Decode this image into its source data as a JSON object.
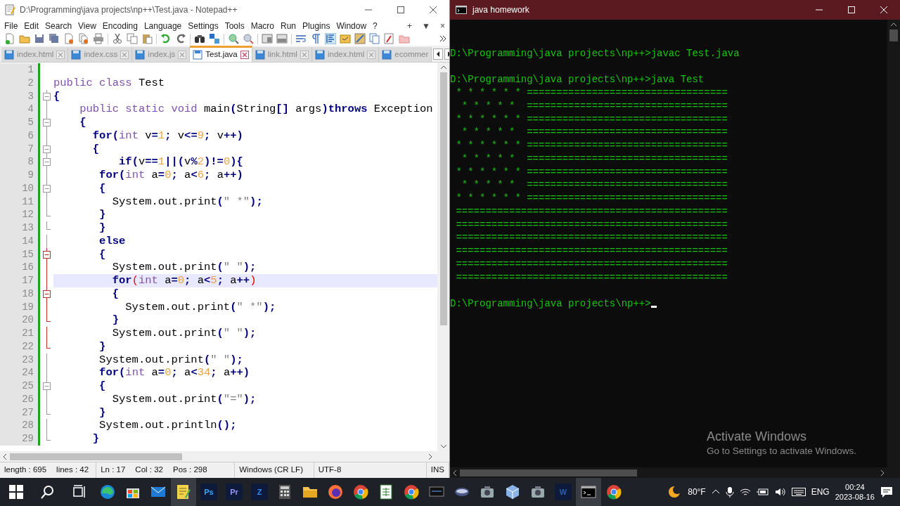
{
  "editor_window": {
    "title": "D:\\Programming\\java projects\\np++\\Test.java - Notepad++",
    "menu": [
      "File",
      "Edit",
      "Search",
      "View",
      "Encoding",
      "Language",
      "Settings",
      "Tools",
      "Macro",
      "Run",
      "Plugins",
      "Window",
      "?"
    ],
    "menu_extras": [
      "+",
      "▼",
      "×"
    ],
    "tabs": [
      {
        "label": "index.html",
        "selected": false
      },
      {
        "label": "index.css",
        "selected": false
      },
      {
        "label": "index.js",
        "selected": false
      },
      {
        "label": "Test.java",
        "selected": true
      },
      {
        "label": "link.html",
        "selected": false
      },
      {
        "label": "index.html",
        "selected": false
      },
      {
        "label": "ecommer",
        "selected": false
      }
    ],
    "lines": [
      {
        "number": "1",
        "kind": "plain",
        "current": false
      },
      {
        "number": "2",
        "kind": "plain",
        "current": false,
        "tokens": [
          {
            "kind": "modifier",
            "text": "public class"
          },
          {
            "kind": "plain",
            "text": " Test"
          }
        ]
      },
      {
        "number": "3",
        "kind": "open",
        "changed": false,
        "current": false,
        "tokens": [
          {
            "kind": "operator",
            "text": "{"
          }
        ]
      },
      {
        "number": "4",
        "kind": "guide",
        "changed": false,
        "current": false,
        "tokens": [
          {
            "kind": "modifier",
            "text": "    public static void"
          },
          {
            "kind": "plain",
            "text": " main"
          },
          {
            "kind": "operator",
            "text": "("
          },
          {
            "kind": "plain",
            "text": "String"
          },
          {
            "kind": "operator",
            "text": "[]"
          },
          {
            "kind": "plain",
            "text": " args"
          },
          {
            "kind": "operator",
            "text": ")"
          },
          {
            "kind": "keyword",
            "text": "throws"
          },
          {
            "kind": "plain",
            "text": " Exception"
          }
        ]
      },
      {
        "number": "5",
        "kind": "open",
        "changed": false,
        "current": false,
        "tokens": [
          {
            "kind": "operator",
            "text": "    {"
          }
        ]
      },
      {
        "number": "6",
        "kind": "guide",
        "changed": false,
        "current": false,
        "tokens": [
          {
            "kind": "keyword",
            "text": "      for"
          },
          {
            "kind": "operator",
            "text": "("
          },
          {
            "kind": "modifier",
            "text": "int"
          },
          {
            "kind": "plain",
            "text": " v"
          },
          {
            "kind": "operator",
            "text": "="
          },
          {
            "kind": "number",
            "text": "1"
          },
          {
            "kind": "operator",
            "text": ";"
          },
          {
            "kind": "plain",
            "text": " v"
          },
          {
            "kind": "operator",
            "text": "<="
          },
          {
            "kind": "number",
            "text": "9"
          },
          {
            "kind": "operator",
            "text": ";"
          },
          {
            "kind": "plain",
            "text": " v"
          },
          {
            "kind": "operator",
            "text": "++)"
          }
        ]
      },
      {
        "number": "7",
        "kind": "open",
        "changed": false,
        "current": false,
        "tokens": [
          {
            "kind": "operator",
            "text": "      {"
          }
        ]
      },
      {
        "number": "8",
        "kind": "open",
        "changed": false,
        "current": false,
        "tokens": [
          {
            "kind": "keyword",
            "text": "          if"
          },
          {
            "kind": "operator",
            "text": "("
          },
          {
            "kind": "plain",
            "text": "v"
          },
          {
            "kind": "operator",
            "text": "=="
          },
          {
            "kind": "number",
            "text": "1"
          },
          {
            "kind": "operator",
            "text": "||("
          },
          {
            "kind": "plain",
            "text": "v"
          },
          {
            "kind": "operator",
            "text": "%"
          },
          {
            "kind": "number",
            "text": "2"
          },
          {
            "kind": "operator",
            "text": ")!="
          },
          {
            "kind": "number",
            "text": "0"
          },
          {
            "kind": "operator",
            "text": "){"
          }
        ]
      },
      {
        "number": "9",
        "kind": "guide",
        "changed": false,
        "current": false,
        "tokens": [
          {
            "kind": "keyword",
            "text": "       for"
          },
          {
            "kind": "operator",
            "text": "("
          },
          {
            "kind": "modifier",
            "text": "int"
          },
          {
            "kind": "plain",
            "text": " a"
          },
          {
            "kind": "operator",
            "text": "="
          },
          {
            "kind": "number",
            "text": "0"
          },
          {
            "kind": "operator",
            "text": ";"
          },
          {
            "kind": "plain",
            "text": " a"
          },
          {
            "kind": "operator",
            "text": "<"
          },
          {
            "kind": "number",
            "text": "6"
          },
          {
            "kind": "operator",
            "text": ";"
          },
          {
            "kind": "plain",
            "text": " a"
          },
          {
            "kind": "operator",
            "text": "++)"
          }
        ]
      },
      {
        "number": "10",
        "kind": "open",
        "changed": false,
        "current": false,
        "tokens": [
          {
            "kind": "operator",
            "text": "       {"
          }
        ]
      },
      {
        "number": "11",
        "kind": "guide",
        "changed": false,
        "current": false,
        "tokens": [
          {
            "kind": "plain",
            "text": "         System.out.print"
          },
          {
            "kind": "operator",
            "text": "("
          },
          {
            "kind": "string",
            "text": "\" *\""
          },
          {
            "kind": "operator",
            "text": ");"
          }
        ]
      },
      {
        "number": "12",
        "kind": "end",
        "changed": false,
        "current": false,
        "tokens": [
          {
            "kind": "operator",
            "text": "       }"
          }
        ]
      },
      {
        "number": "13",
        "kind": "end",
        "changed": false,
        "current": false,
        "tokens": [
          {
            "kind": "operator",
            "text": "       }"
          }
        ]
      },
      {
        "number": "14",
        "kind": "guide",
        "changed": false,
        "current": false,
        "tokens": [
          {
            "kind": "keyword",
            "text": "       else"
          }
        ]
      },
      {
        "number": "15",
        "kind": "open",
        "changed": true,
        "current": false,
        "tokens": [
          {
            "kind": "operator",
            "text": "       {"
          }
        ]
      },
      {
        "number": "16",
        "kind": "guide",
        "changed": true,
        "current": false,
        "tokens": [
          {
            "kind": "plain",
            "text": "         System.out.print"
          },
          {
            "kind": "operator",
            "text": "("
          },
          {
            "kind": "string",
            "text": "\" \""
          },
          {
            "kind": "operator",
            "text": ");"
          }
        ]
      },
      {
        "number": "17",
        "kind": "guide",
        "changed": true,
        "current": true,
        "tokens": [
          {
            "kind": "keyword",
            "text": "         for"
          },
          {
            "kind": "match",
            "text": "("
          },
          {
            "kind": "modifier",
            "text": "int"
          },
          {
            "kind": "plain",
            "text": " a"
          },
          {
            "kind": "operator",
            "text": "="
          },
          {
            "kind": "number",
            "text": "0"
          },
          {
            "kind": "operator",
            "text": ";"
          },
          {
            "kind": "plain",
            "text": " a"
          },
          {
            "kind": "operator",
            "text": "<"
          },
          {
            "kind": "number",
            "text": "5"
          },
          {
            "kind": "operator",
            "text": ";"
          },
          {
            "kind": "plain",
            "text": " a"
          },
          {
            "kind": "operator",
            "text": "++"
          },
          {
            "kind": "match",
            "text": ")"
          }
        ]
      },
      {
        "number": "18",
        "kind": "open",
        "changed": true,
        "current": false,
        "tokens": [
          {
            "kind": "operator",
            "text": "         {"
          }
        ]
      },
      {
        "number": "19",
        "kind": "guide",
        "changed": true,
        "current": false,
        "tokens": [
          {
            "kind": "plain",
            "text": "           System.out.print"
          },
          {
            "kind": "operator",
            "text": "("
          },
          {
            "kind": "string",
            "text": "\" *\""
          },
          {
            "kind": "operator",
            "text": ");"
          }
        ]
      },
      {
        "number": "20",
        "kind": "end",
        "changed": true,
        "current": false,
        "tokens": [
          {
            "kind": "operator",
            "text": "         }"
          }
        ]
      },
      {
        "number": "21",
        "kind": "guide",
        "changed": true,
        "current": false,
        "tokens": [
          {
            "kind": "plain",
            "text": "         System.out.print"
          },
          {
            "kind": "operator",
            "text": "("
          },
          {
            "kind": "string",
            "text": "\" \""
          },
          {
            "kind": "operator",
            "text": ");"
          }
        ]
      },
      {
        "number": "22",
        "kind": "end",
        "changed": true,
        "current": false,
        "tokens": [
          {
            "kind": "operator",
            "text": "       }"
          }
        ]
      },
      {
        "number": "23",
        "kind": "guide",
        "changed": false,
        "current": false,
        "tokens": [
          {
            "kind": "plain",
            "text": "       System.out.print"
          },
          {
            "kind": "operator",
            "text": "("
          },
          {
            "kind": "string",
            "text": "\" \""
          },
          {
            "kind": "operator",
            "text": ");"
          }
        ]
      },
      {
        "number": "24",
        "kind": "guide",
        "changed": false,
        "current": false,
        "tokens": [
          {
            "kind": "keyword",
            "text": "       for"
          },
          {
            "kind": "operator",
            "text": "("
          },
          {
            "kind": "modifier",
            "text": "int"
          },
          {
            "kind": "plain",
            "text": " a"
          },
          {
            "kind": "operator",
            "text": "="
          },
          {
            "kind": "number",
            "text": "0"
          },
          {
            "kind": "operator",
            "text": ";"
          },
          {
            "kind": "plain",
            "text": " a"
          },
          {
            "kind": "operator",
            "text": "<"
          },
          {
            "kind": "number",
            "text": "34"
          },
          {
            "kind": "operator",
            "text": ";"
          },
          {
            "kind": "plain",
            "text": " a"
          },
          {
            "kind": "operator",
            "text": "++)"
          }
        ]
      },
      {
        "number": "25",
        "kind": "open",
        "changed": false,
        "current": false,
        "tokens": [
          {
            "kind": "operator",
            "text": "       {"
          }
        ]
      },
      {
        "number": "26",
        "kind": "guide",
        "changed": false,
        "current": false,
        "tokens": [
          {
            "kind": "plain",
            "text": "         System.out.print"
          },
          {
            "kind": "operator",
            "text": "("
          },
          {
            "kind": "string",
            "text": "\"=\""
          },
          {
            "kind": "operator",
            "text": ");"
          }
        ]
      },
      {
        "number": "27",
        "kind": "end",
        "changed": false,
        "current": false,
        "tokens": [
          {
            "kind": "operator",
            "text": "       }"
          }
        ]
      },
      {
        "number": "28",
        "kind": "guide",
        "changed": false,
        "current": false,
        "tokens": [
          {
            "kind": "plain",
            "text": "       System.out.println"
          },
          {
            "kind": "operator",
            "text": "();"
          }
        ]
      },
      {
        "number": "29",
        "kind": "end",
        "changed": false,
        "current": false,
        "tokens": [
          {
            "kind": "operator",
            "text": "      }"
          }
        ]
      }
    ],
    "status_bar": [
      [
        "length : 695",
        "lines : 42"
      ],
      [
        "Ln : 17",
        "Col : 32",
        "Pos : 298"
      ],
      [
        "Windows (CR LF)"
      ],
      [
        "UTF-8"
      ],
      [
        "INS"
      ]
    ]
  },
  "terminal_window": {
    "title": "java homework",
    "lines": [
      {
        "kind": "blank"
      },
      {
        "kind": "text",
        "text": "D:\\Programming\\java projects\\np++>javac Test.java"
      },
      {
        "kind": "blank"
      },
      {
        "kind": "text",
        "text": "D:\\Programming\\java projects\\np++>java Test"
      },
      {
        "kind": "text",
        "text": " * * * * * * =================================="
      },
      {
        "kind": "text",
        "text": "  * * * * *  =================================="
      },
      {
        "kind": "text",
        "text": " * * * * * * =================================="
      },
      {
        "kind": "text",
        "text": "  * * * * *  =================================="
      },
      {
        "kind": "text",
        "text": " * * * * * * =================================="
      },
      {
        "kind": "text",
        "text": "  * * * * *  =================================="
      },
      {
        "kind": "text",
        "text": " * * * * * * =================================="
      },
      {
        "kind": "text",
        "text": "  * * * * *  =================================="
      },
      {
        "kind": "text",
        "text": " * * * * * * =================================="
      },
      {
        "kind": "text",
        "text": " =============================================="
      },
      {
        "kind": "text",
        "text": " =============================================="
      },
      {
        "kind": "text",
        "text": " =============================================="
      },
      {
        "kind": "text",
        "text": " =============================================="
      },
      {
        "kind": "text",
        "text": " =============================================="
      },
      {
        "kind": "text",
        "text": " =============================================="
      },
      {
        "kind": "blank"
      },
      {
        "kind": "prompt",
        "text": "D:\\Programming\\java projects\\np++>",
        "cursor": true
      }
    ]
  },
  "activation_notice": {
    "title": "Activate Windows",
    "text": "Go to Settings to activate Windows."
  },
  "taskbar": {
    "apps": [
      {
        "kind": "windows",
        "active": false
      },
      {
        "kind": "search",
        "active": false
      },
      {
        "kind": "taskview",
        "active": false
      },
      {
        "kind": "edge",
        "active": false
      },
      {
        "kind": "store",
        "active": false
      },
      {
        "kind": "mail",
        "active": false
      },
      {
        "kind": "notepad",
        "active": true
      },
      {
        "kind": "square",
        "glyph": "Ps",
        "color": "#31a8ff",
        "active": false
      },
      {
        "kind": "square",
        "glyph": "Pr",
        "color": "#9999ff",
        "active": false
      },
      {
        "kind": "square",
        "glyph": "Z",
        "color": "#2d8cff",
        "active": false
      },
      {
        "kind": "calc",
        "active": false
      },
      {
        "kind": "folder",
        "active": false
      },
      {
        "kind": "firefox",
        "active": false
      },
      {
        "kind": "chrome",
        "active": false
      },
      {
        "kind": "sheet",
        "active": false
      },
      {
        "kind": "chrome",
        "active": false
      },
      {
        "kind": "monitor",
        "active": false
      },
      {
        "kind": "disk",
        "active": false
      },
      {
        "kind": "camera",
        "active": false
      },
      {
        "kind": "cube",
        "active": false
      },
      {
        "kind": "camera",
        "active": false
      },
      {
        "kind": "square",
        "glyph": "W",
        "color": "#2b5fb4",
        "active": false
      },
      {
        "kind": "cmd",
        "active": true
      },
      {
        "kind": "chrome",
        "active": false
      }
    ],
    "temperature": "80°F",
    "language": "ENG",
    "time": "00:24",
    "date": "2023-08-16"
  }
}
